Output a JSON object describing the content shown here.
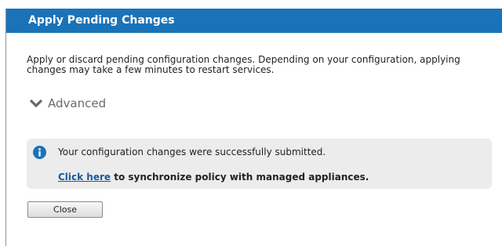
{
  "dialog": {
    "title": "Apply Pending Changes",
    "description": "Apply or discard pending configuration changes. Depending on your configuration, applying changes may take a few minutes to restart services.",
    "advanced": {
      "label": "Advanced",
      "icon": "chevron-down-icon"
    },
    "notice": {
      "icon": "info-icon",
      "message": "Your configuration changes were successfully submitted.",
      "link_text": "Click here",
      "link_suffix": " to synchronize policy with managed appliances."
    },
    "close_label": "Close"
  },
  "colors": {
    "titlebar": "#1a73b8",
    "notice_background": "#ececec",
    "info_icon": "#1a73b8",
    "link": "#1a5a9a"
  }
}
